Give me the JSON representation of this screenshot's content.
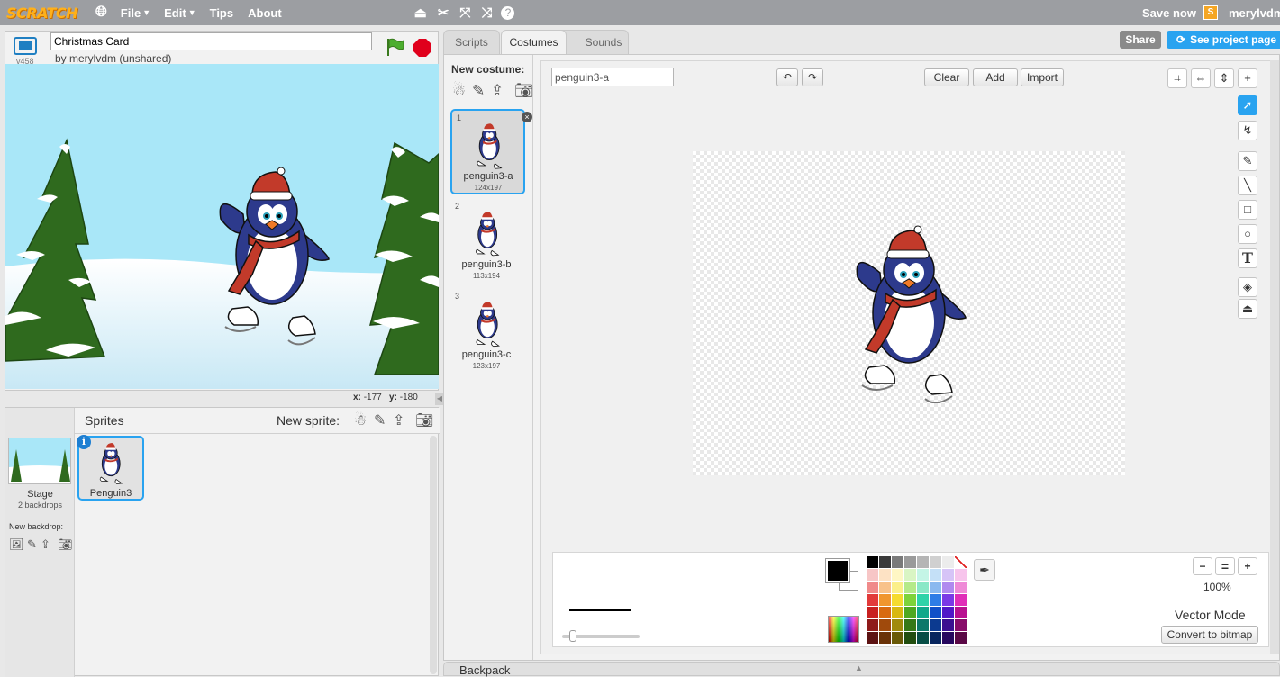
{
  "topbar": {
    "logo": "SCRATCH",
    "menu": [
      "File",
      "Edit",
      "Tips",
      "About"
    ],
    "save_now": "Save now",
    "user_avatar": "S",
    "username": "merylvdm"
  },
  "project": {
    "version": "v458",
    "title": "Christmas Card",
    "byline": "by merylvdm (unshared)"
  },
  "stage": {
    "mouse_x_label": "x:",
    "mouse_x": "-177",
    "mouse_y_label": "y:",
    "mouse_y": "-180"
  },
  "sprites_panel": {
    "title": "Sprites",
    "new_sprite_label": "New sprite:",
    "stage_label": "Stage",
    "stage_backdrops": "2 backdrops",
    "new_backdrop_label": "New backdrop:",
    "sprites": [
      {
        "name": "Penguin3",
        "selected": true
      }
    ]
  },
  "tabs": [
    {
      "label": "Scripts",
      "active": false
    },
    {
      "label": "Costumes",
      "active": true
    },
    {
      "label": "Sounds",
      "active": false
    }
  ],
  "header_buttons": {
    "share": "Share",
    "see_project": "See project page"
  },
  "costume_panel": {
    "new_costume_label": "New costume:",
    "costumes": [
      {
        "num": "1",
        "name": "penguin3-a",
        "size": "124x197",
        "selected": true
      },
      {
        "num": "2",
        "name": "penguin3-b",
        "size": "113x194",
        "selected": false
      },
      {
        "num": "3",
        "name": "penguin3-c",
        "size": "123x197",
        "selected": false
      }
    ]
  },
  "paint_editor": {
    "costume_name": "penguin3-a",
    "clear_label": "Clear",
    "add_label": "Add",
    "import_label": "Import",
    "zoom_level": "100%",
    "mode": "Vector Mode",
    "convert_label": "Convert to bitmap",
    "primary_color": "#000000",
    "secondary_color": "#ffffff",
    "palette": [
      "#000000",
      "#3a3a3a",
      "#7a7a7a",
      "#9a9a9a",
      "#b5b5b5",
      "#d0d0d0",
      "#ececec",
      "#ffffff",
      "#f7c6c6",
      "#fde2c4",
      "#fff7c4",
      "#d9f5c4",
      "#c4f5e6",
      "#c4e0f7",
      "#d6c4f7",
      "#f7c4ec",
      "#f08a8a",
      "#f8c28a",
      "#fbef8a",
      "#b5ea8a",
      "#8ae8c7",
      "#8ab9ef",
      "#b08aef",
      "#ef8ad7",
      "#e23a3a",
      "#f0962e",
      "#f5db2e",
      "#7ed33a",
      "#2ed3a8",
      "#2e7de6",
      "#7a3ae6",
      "#e02eb8",
      "#c82020",
      "#d86a10",
      "#d8b810",
      "#4ea820",
      "#10a88a",
      "#1050c8",
      "#5018c8",
      "#b81090",
      "#8e1a1a",
      "#a04a0c",
      "#a08a0c",
      "#357818",
      "#0c786a",
      "#0c3a90",
      "#3a1090",
      "#880c6a",
      "#5c1212",
      "#6a3208",
      "#6a5a08",
      "#224e10",
      "#084e46",
      "#08265e",
      "#26085e",
      "#5a0846"
    ]
  },
  "backpack": {
    "label": "Backpack"
  }
}
